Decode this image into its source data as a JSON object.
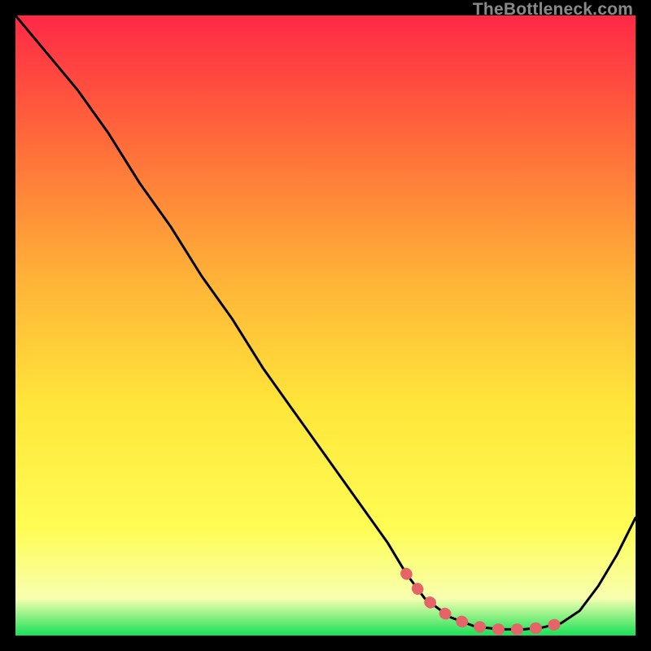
{
  "watermark": "TheBottleneck.com",
  "colors": {
    "gradient_top": "#ff2846",
    "gradient_mid1": "#ff6a3a",
    "gradient_mid2": "#ffb138",
    "gradient_mid3": "#ffe63a",
    "gradient_mid4": "#fffd55",
    "gradient_low": "#f7ffb0",
    "gradient_bottom": "#18e056",
    "curve": "#000000",
    "highlight": "#e46468"
  },
  "chart_data": {
    "type": "line",
    "title": "",
    "xlabel": "",
    "ylabel": "",
    "xlim": [
      0,
      100
    ],
    "ylim": [
      0,
      100
    ],
    "series": [
      {
        "name": "bottleneck-curve",
        "x": [
          0,
          5,
          10,
          15,
          20,
          25,
          30,
          35,
          40,
          45,
          50,
          55,
          60,
          63,
          66,
          70,
          74,
          78,
          82,
          85,
          88,
          91,
          94,
          97,
          100
        ],
        "y": [
          100,
          94,
          88,
          81,
          73,
          66,
          58,
          51,
          43,
          36,
          29,
          22,
          15,
          10,
          6,
          3,
          1.5,
          1,
          1,
          1.3,
          2,
          4,
          8,
          13,
          19
        ]
      },
      {
        "name": "optimal-range-highlight",
        "x": [
          63,
          66,
          70,
          74,
          78,
          82,
          85,
          88
        ],
        "y": [
          10,
          6,
          3,
          1.5,
          1,
          1,
          1.3,
          2
        ]
      }
    ],
    "annotations": []
  }
}
